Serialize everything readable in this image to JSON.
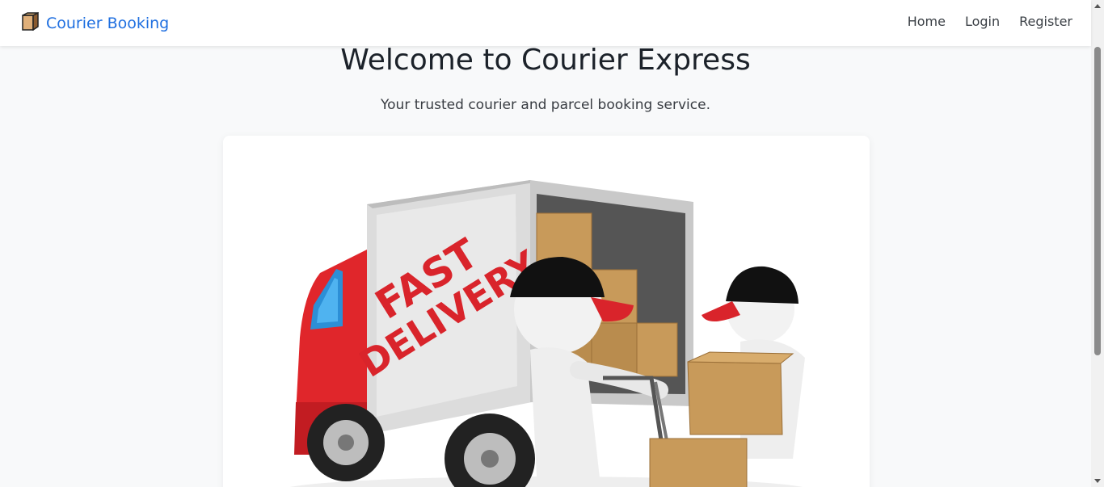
{
  "navbar": {
    "brand": {
      "icon": "package-icon",
      "label": "Courier Booking"
    },
    "links": [
      {
        "label": "Home"
      },
      {
        "label": "Login"
      },
      {
        "label": "Register"
      }
    ]
  },
  "hero": {
    "title": "Welcome to Courier Express",
    "subtitle": "Your trusted courier and parcel booking service.",
    "image_text": {
      "line1": "FAST",
      "line2": "DELIVERY"
    }
  },
  "colors": {
    "brand": "#1f6fe0",
    "truck_red": "#e0262b",
    "box_tan": "#c89a5a",
    "page_bg": "#f8f9fa"
  }
}
